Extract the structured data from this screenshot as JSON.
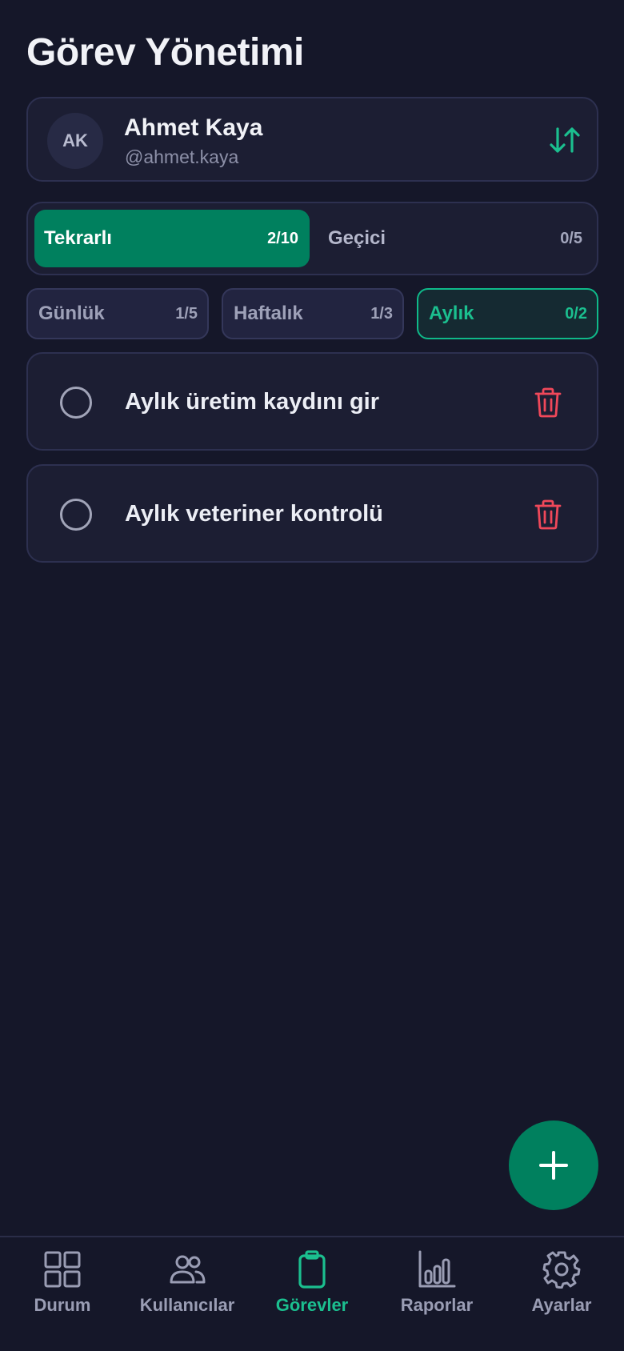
{
  "page": {
    "title": "Görev Yönetimi"
  },
  "user": {
    "initials": "AK",
    "name": "Ahmet Kaya",
    "handle": "@ahmet.kaya"
  },
  "segments": [
    {
      "label": "Tekrarlı",
      "count": "2/10",
      "active": true
    },
    {
      "label": "Geçici",
      "count": "0/5",
      "active": false
    }
  ],
  "filters": [
    {
      "label": "Günlük",
      "count": "1/5",
      "active": false
    },
    {
      "label": "Haftalık",
      "count": "1/3",
      "active": false
    },
    {
      "label": "Aylık",
      "count": "0/2",
      "active": true
    }
  ],
  "tasks": [
    {
      "text": "Aylık üretim kaydını gir",
      "done": false
    },
    {
      "text": "Aylık veteriner kontrolü",
      "done": false
    }
  ],
  "nav": [
    {
      "label": "Durum",
      "icon": "grid-icon",
      "active": false
    },
    {
      "label": "Kullanıcılar",
      "icon": "users-icon",
      "active": false
    },
    {
      "label": "Görevler",
      "icon": "clipboard-icon",
      "active": true
    },
    {
      "label": "Raporlar",
      "icon": "bar-chart-icon",
      "active": false
    },
    {
      "label": "Ayarlar",
      "icon": "gear-icon",
      "active": false
    }
  ],
  "colors": {
    "background": "#151729",
    "card": "#1c1e33",
    "accent": "#00805e",
    "accent_text": "#1bbf8f",
    "danger": "#f0485a"
  },
  "fab": {
    "icon": "plus-icon"
  }
}
